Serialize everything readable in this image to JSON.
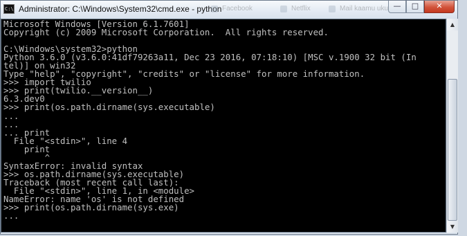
{
  "window": {
    "title": "Administrator: C:\\Windows\\System32\\cmd.exe - python",
    "app_icon_text": "C:\\",
    "buttons": {
      "minimize": "—",
      "maximize": "□",
      "close": "✕"
    },
    "background_tabs": [
      "Facebook",
      "Netflix",
      "Mail kaamu ukubu"
    ]
  },
  "console": {
    "foreground": "#c0c0c0",
    "background": "#000000",
    "lines": [
      "Microsoft Windows [Version 6.1.7601]",
      "Copyright (c) 2009 Microsoft Corporation.  All rights reserved.",
      "",
      "C:\\Windows\\system32>python",
      "Python 3.6.0 (v3.6.0:41df79263a11, Dec 23 2016, 07:18:10) [MSC v.1900 32 bit (In",
      "tel)] on win32",
      "Type \"help\", \"copyright\", \"credits\" or \"license\" for more information.",
      ">>> import twilio",
      ">>> print(twilio.__version__)",
      "6.3.dev0",
      ">>> print(os.path.dirname(sys.executable)",
      "...",
      "...",
      "... print",
      "  File \"<stdin>\", line 4",
      "    print",
      "        ^",
      "SyntaxError: invalid syntax",
      ">>> os.path.dirname(sys.executable)",
      "Traceback (most recent call last):",
      "  File \"<stdin>\", line 1, in <module>",
      "NameError: name 'os' is not defined",
      ">>> print(os.path.dirname(sys.exe)",
      "..."
    ]
  },
  "scrollbar": {
    "up_arrow": "▲",
    "down_arrow": "▼",
    "position": 1.0
  }
}
